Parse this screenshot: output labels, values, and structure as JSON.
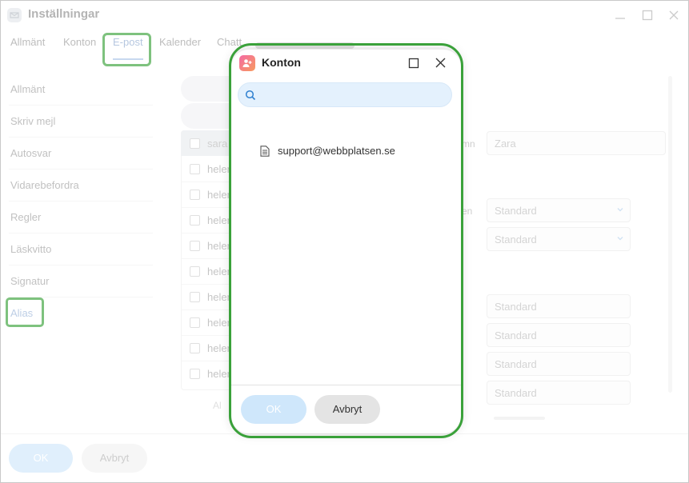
{
  "window": {
    "title": "Inställningar"
  },
  "tabs": [
    {
      "label": "Allmänt"
    },
    {
      "label": "Konton"
    },
    {
      "label": "E-post"
    },
    {
      "label": "Kalender"
    },
    {
      "label": "Chatt"
    }
  ],
  "sidebar": {
    "items": [
      {
        "label": "Allmänt"
      },
      {
        "label": "Skriv mejl"
      },
      {
        "label": "Autosvar"
      },
      {
        "label": "Vidarebefordra"
      },
      {
        "label": "Regler"
      },
      {
        "label": "Läskvitto"
      },
      {
        "label": "Signatur"
      },
      {
        "label": "Alias"
      }
    ],
    "active": "Alias"
  },
  "background": {
    "list_header": "sara",
    "rows": [
      "helen",
      "helen",
      "helen",
      "helen",
      "helen",
      "helen",
      "helen",
      "helen",
      "helen"
    ],
    "name_label_fragment": "mn",
    "name_value": "Zara",
    "select_label_fragment": "en",
    "select_values": [
      "Standard",
      "Standard"
    ],
    "field_values": [
      "Standard",
      "Standard",
      "Standard",
      "Standard"
    ],
    "bottom_fragment": "Al"
  },
  "footer": {
    "ok_label": "OK",
    "cancel_label": "Avbryt"
  },
  "dialog": {
    "title": "Konton",
    "search": {
      "value": "",
      "placeholder": ""
    },
    "accounts": [
      "support@webbplatsen.se"
    ],
    "ok_label": "OK",
    "cancel_label": "Avbryt"
  },
  "colors": {
    "highlight": "#3aa13a",
    "accent_light": "#cfe7fb",
    "search_bg": "#e4f1fd",
    "dialog_icon_gradient": [
      "#f46aa4",
      "#f79b5e"
    ]
  },
  "icons": {
    "app": "mail-app-icon",
    "dialog": "contacts-icon",
    "search": "search-icon",
    "account": "document-icon"
  }
}
